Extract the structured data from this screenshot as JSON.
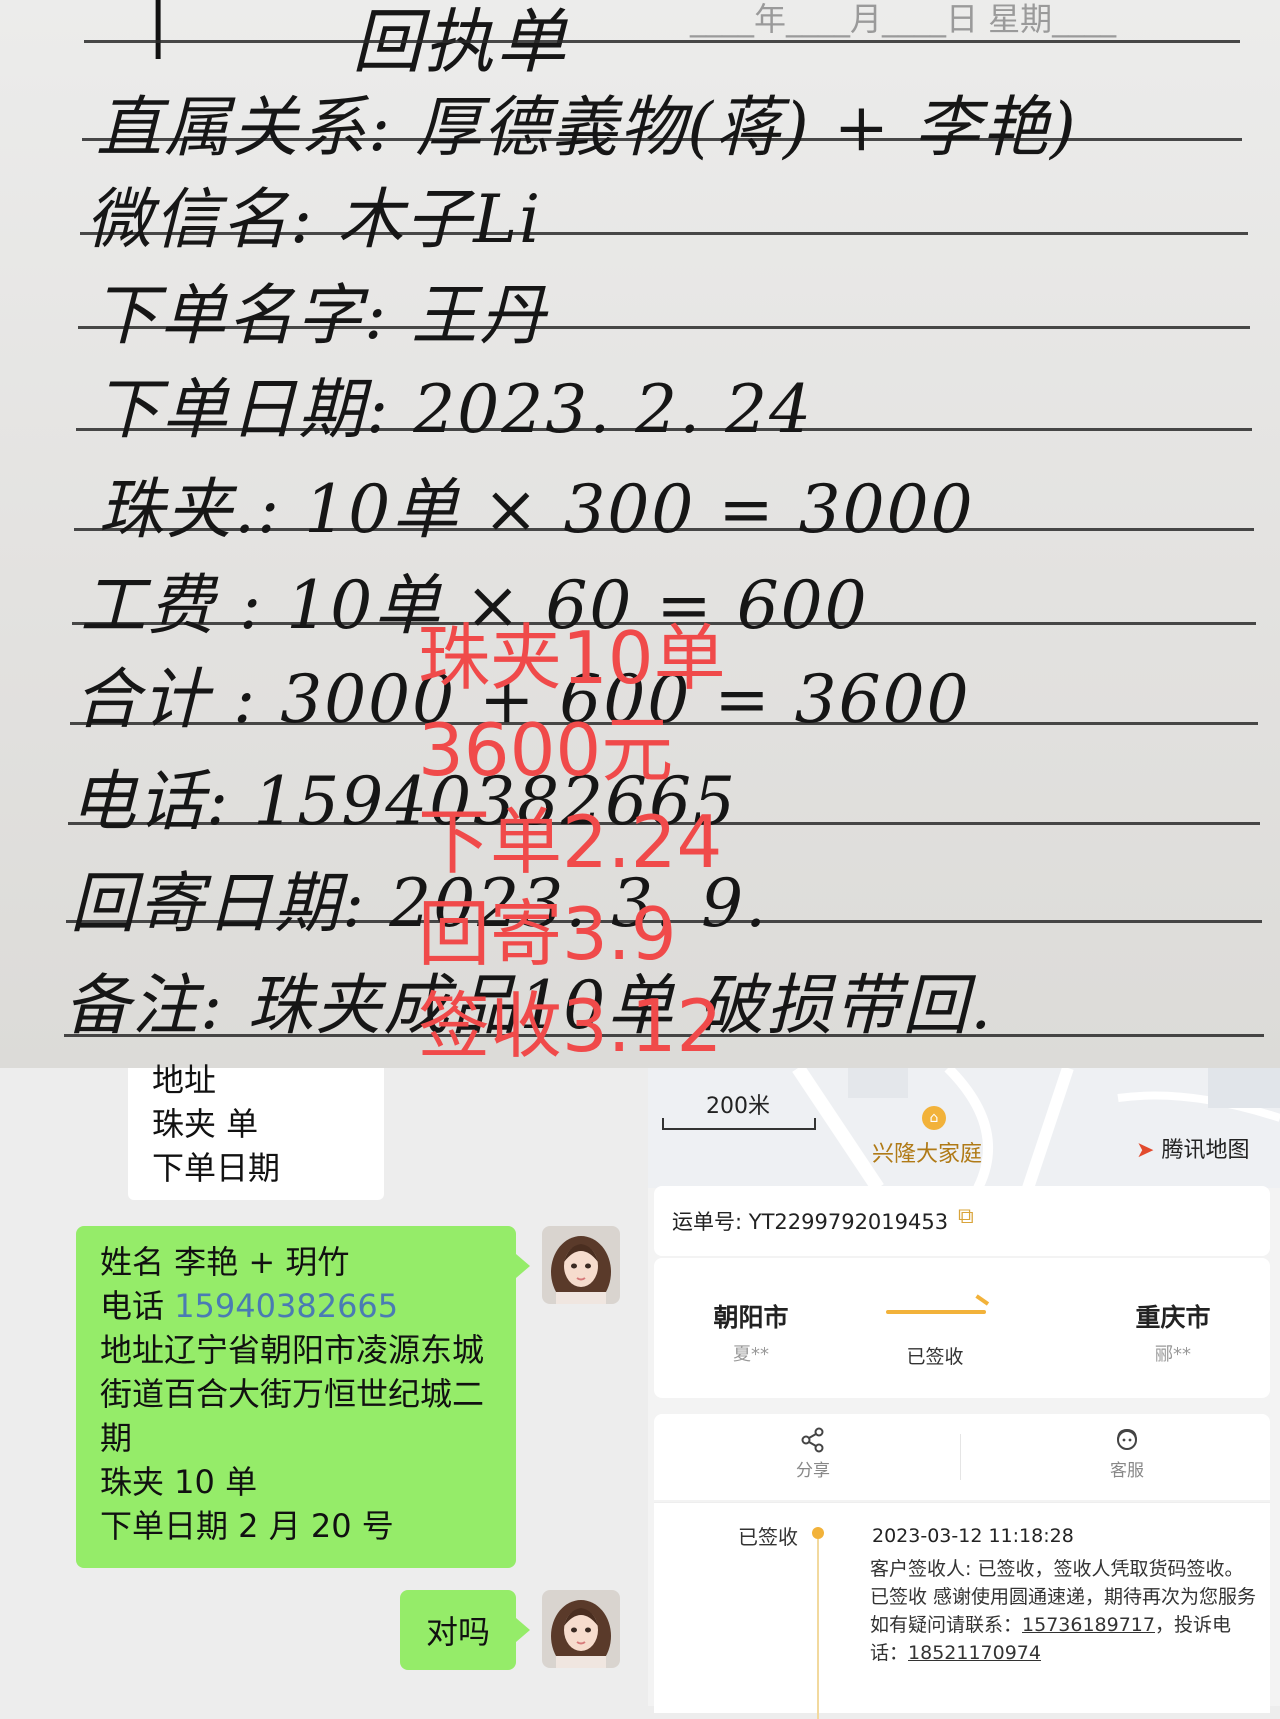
{
  "receipt": {
    "title": "回执单",
    "header_date": "____年____月____日  星期____",
    "lines": [
      {
        "label": "直属关系:",
        "value": "厚德義物(蒋) + 李艳)"
      },
      {
        "label": "微信名:",
        "value": "木子Li"
      },
      {
        "label": "下单名字:",
        "value": "王丹"
      },
      {
        "label": "下单日期:",
        "value": "2023. 2. 24"
      },
      {
        "label": "珠夹.:",
        "value": "10单 × 300 = 3000"
      },
      {
        "label": "工费 :",
        "value": "10单 × 60 = 600"
      },
      {
        "label": "合计 :",
        "value": "3000 + 600 = 3600"
      },
      {
        "label": "电话:",
        "value": "15940382665"
      },
      {
        "label": "回寄日期:",
        "value": "2023. 3. 9."
      },
      {
        "label": "备注:",
        "value": "珠夹成品10单 破损带回."
      }
    ]
  },
  "overlay": {
    "lines": [
      "珠夹10单",
      "3600元",
      "下单2.24",
      "回寄3.9",
      "签收3.12"
    ],
    "color": "#f04a4a"
  },
  "chat": {
    "prev_message": [
      "地址",
      "珠夹   单",
      "下单日期"
    ],
    "info_message": {
      "name_line": "姓名  李艳   + 玥竹",
      "phone_label": "电话 ",
      "phone": "15940382665",
      "address": "地址辽宁省朝阳市凌源东城街道百合大街万恒世纪城二期",
      "item": "珠夹 10  单",
      "order_date": "下单日期 2 月 20 号"
    },
    "short_message": "对吗",
    "bubble_color": "#95ec69"
  },
  "logistics": {
    "map": {
      "scale": "200米",
      "poi": "兴隆大家庭",
      "provider": "腾讯地图"
    },
    "waybill": "运单号: YT2299792019453",
    "from_city": "朝阳市",
    "from_person": "夏**",
    "to_city": "重庆市",
    "to_person": "郦**",
    "route_status": "已签收",
    "actions": [
      {
        "label": "分享",
        "icon": "share-icon"
      },
      {
        "label": "客服",
        "icon": "customer-service-icon"
      }
    ],
    "timeline": {
      "status": "已签收",
      "time": "2023-03-12 11:18:28",
      "text_main": "客户签收人: 已签收，签收人凭取货码签收。 已签收 感谢使用圆通速递，期待再次为您服务 如有疑问请联系：",
      "contact_phone": "15736189717",
      "complaint_label": "，投诉电话：",
      "complaint_phone": "18521170974"
    },
    "accent_color": "#f2b23a"
  }
}
